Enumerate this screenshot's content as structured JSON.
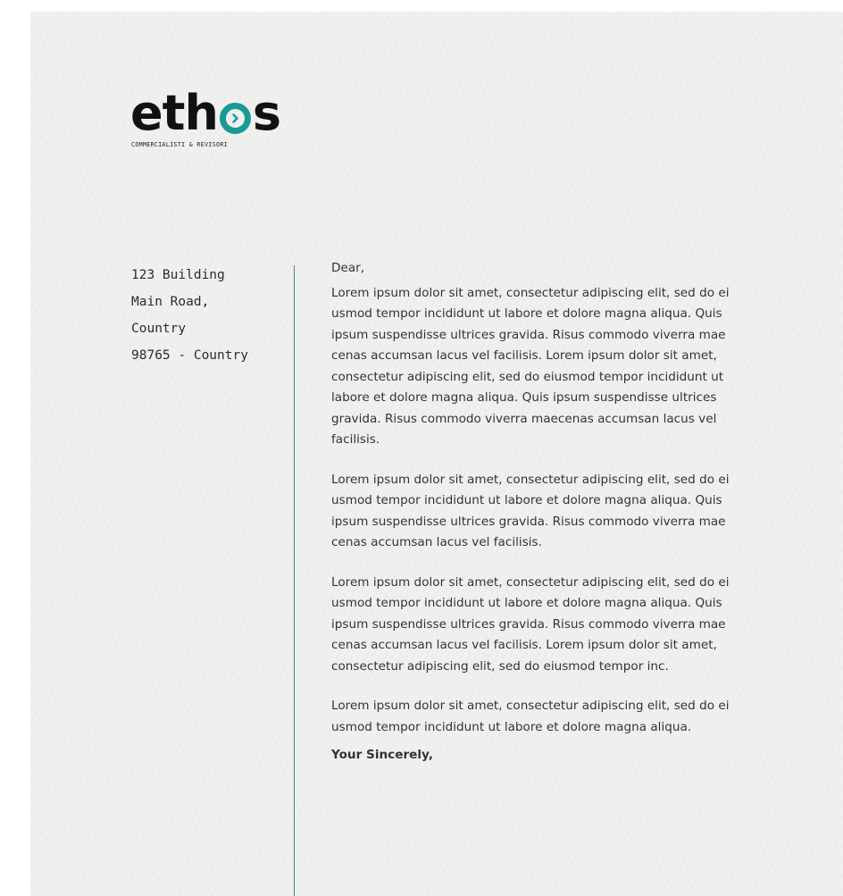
{
  "logo": {
    "part1": "eth",
    "part2": "s",
    "tagline": "COMMERCIALISTI & REVISORI",
    "accent_color": "#1a9a97"
  },
  "address": {
    "lines": [
      "123 Building",
      "Main Road,",
      "Country",
      "98765 - Country"
    ]
  },
  "letter": {
    "greeting": "Dear,",
    "paragraphs": [
      [
        "Lorem ipsum dolor sit amet, consectetur adipiscing elit, sed do ei",
        "usmod tempor incididunt ut labore et dolore magna aliqua. Quis",
        "ipsum suspendisse ultrices gravida. Risus commodo viverra mae",
        "cenas accumsan lacus vel facilisis. Lorem ipsum dolor sit amet,",
        "consectetur adipiscing elit, sed do eiusmod tempor incididunt ut",
        "labore et dolore magna aliqua. Quis ipsum suspendisse ultrices",
        "gravida. Risus commodo viverra maecenas accumsan lacus vel",
        "facilisis."
      ],
      [
        "Lorem ipsum dolor sit amet, consectetur adipiscing elit, sed do ei",
        "usmod tempor incididunt ut labore et dolore magna aliqua. Quis",
        "ipsum suspendisse ultrices gravida. Risus commodo viverra mae",
        "cenas accumsan lacus vel facilisis."
      ],
      [
        "Lorem ipsum dolor sit amet, consectetur adipiscing elit, sed do ei",
        "usmod tempor incididunt ut labore et dolore magna aliqua. Quis",
        "ipsum suspendisse ultrices gravida. Risus commodo viverra mae",
        "cenas accumsan lacus vel facilisis. Lorem ipsum dolor sit amet,",
        "consectetur adipiscing elit, sed do eiusmod tempor inc."
      ],
      [
        "Lorem ipsum dolor sit amet, consectetur adipiscing elit, sed do ei",
        "usmod tempor incididunt ut labore et dolore magna aliqua."
      ]
    ],
    "closing": "Your Sincerely,"
  },
  "colors": {
    "paper": "#f0f0ef",
    "divider": "#3a8f95",
    "text": "#333333"
  }
}
